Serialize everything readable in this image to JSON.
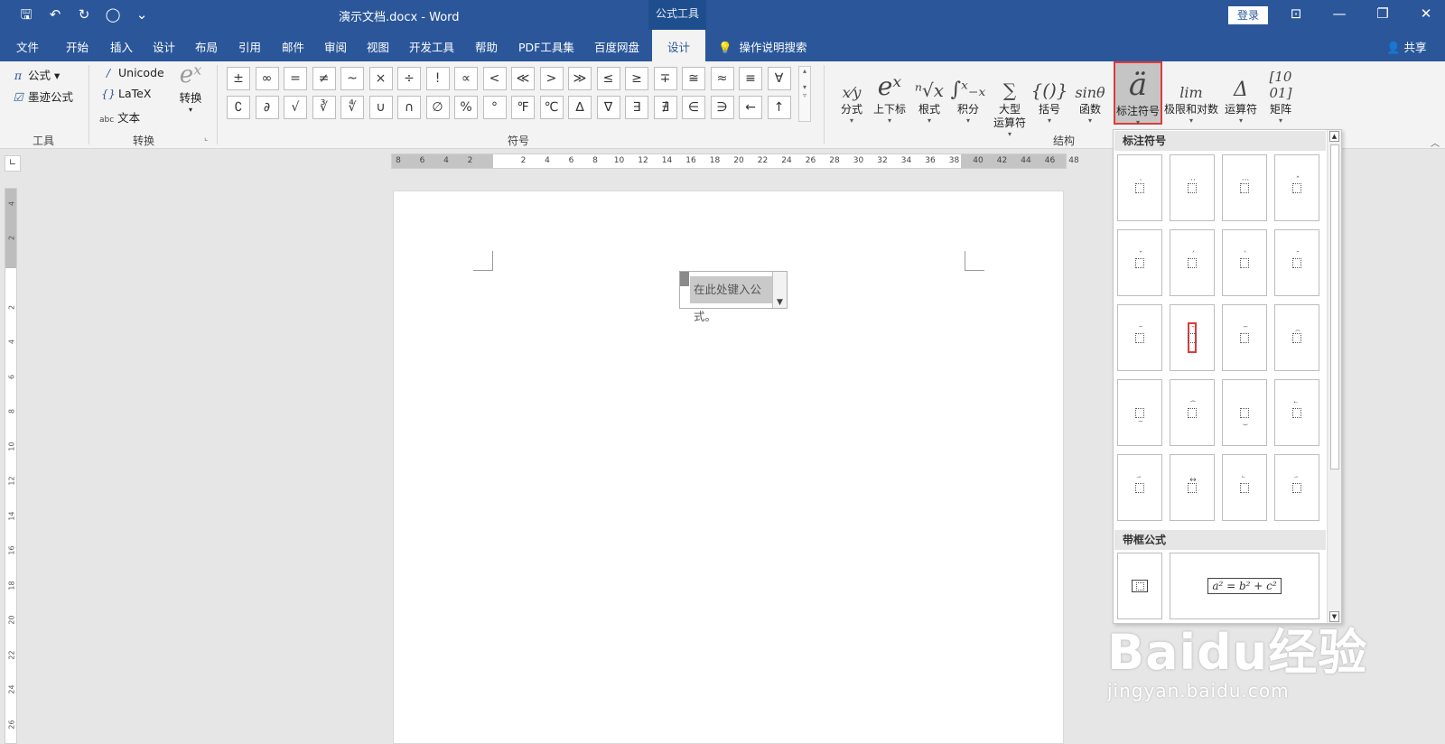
{
  "titlebar": {
    "qat": [
      {
        "name": "save-icon",
        "glyph": "🖫"
      },
      {
        "name": "undo-icon",
        "glyph": "↶"
      },
      {
        "name": "redo-icon",
        "glyph": "↻"
      },
      {
        "name": "circle-icon",
        "glyph": "◯"
      },
      {
        "name": "customize-qat-icon",
        "glyph": "⌄"
      }
    ],
    "doc_title": "演示文档.docx  -  Word",
    "context_tab": "公式工具",
    "login": "登录",
    "controls": {
      "ribbon_display": "⊡",
      "minimize": "—",
      "restore": "❐",
      "close": "✕"
    }
  },
  "tabs": [
    "文件",
    "开始",
    "插入",
    "设计",
    "布局",
    "引用",
    "邮件",
    "审阅",
    "视图",
    "开发工具",
    "帮助",
    "PDF工具集",
    "百度网盘"
  ],
  "active_tab": "设计",
  "tell_me": "操作说明搜索",
  "share": "共享",
  "ribbon": {
    "tools": {
      "equation": "公式",
      "ink_equation": "墨迹公式",
      "label": "工具",
      "pi": "π"
    },
    "convert": {
      "unicode": "Unicode",
      "latex": "LaTeX",
      "text": "文本",
      "convert_btn": "转换",
      "label": "转换",
      "abc": "abc"
    },
    "symbols": {
      "label": "符号",
      "row1": [
        "±",
        "∞",
        "=",
        "≠",
        "~",
        "×",
        "÷",
        "!",
        "∝",
        "<",
        "≪",
        ">",
        "≫",
        "≤",
        "≥",
        "∓",
        "≅",
        "≈",
        "≡",
        "∀"
      ],
      "row2": [
        "∁",
        "∂",
        "√",
        "∛",
        "∜",
        "∪",
        "∩",
        "∅",
        "%",
        "°",
        "℉",
        "℃",
        "∆",
        "∇",
        "∃",
        "∄",
        "∈",
        "∋",
        "←",
        "↑"
      ]
    },
    "structures": {
      "label": "结构",
      "items": [
        {
          "name": "fraction",
          "label": "分式",
          "glyph": "x⁄y"
        },
        {
          "name": "script",
          "label": "上下标",
          "glyph": "eˣ"
        },
        {
          "name": "radical",
          "label": "根式",
          "glyph": "ⁿ√x"
        },
        {
          "name": "integral",
          "label": "积分",
          "glyph": "∫ˣ₋ₓ"
        },
        {
          "name": "large-operator",
          "label": "大型\n运算符",
          "glyph": "∑"
        },
        {
          "name": "bracket",
          "label": "括号",
          "glyph": "{()}"
        },
        {
          "name": "function",
          "label": "函数",
          "glyph": "sinθ"
        },
        {
          "name": "accent",
          "label": "标注符号",
          "glyph": "ä"
        },
        {
          "name": "limit-log",
          "label": "极限和对数",
          "glyph": "lim"
        },
        {
          "name": "operator",
          "label": "运算符",
          "glyph": "Δ"
        },
        {
          "name": "matrix",
          "label": "矩阵",
          "glyph": "[10 01]"
        }
      ]
    }
  },
  "ruler": {
    "h_ticks": [
      "8",
      "6",
      "4",
      "2",
      "2",
      "4",
      "6",
      "8",
      "10",
      "12",
      "14",
      "16",
      "18",
      "20",
      "22",
      "24",
      "26",
      "28",
      "30",
      "32",
      "34",
      "36",
      "38",
      "40",
      "42",
      "44",
      "46",
      "48"
    ],
    "v_ticks": [
      "4",
      "2",
      "2",
      "4",
      "6",
      "8",
      "10",
      "12",
      "14",
      "16",
      "18",
      "20",
      "22",
      "24",
      "26"
    ]
  },
  "document": {
    "equation_placeholder": "在此处键入公式。"
  },
  "gallery": {
    "section_accents": "标注符号",
    "section_boxed": "带框公式",
    "boxed_equation": "a² = b² + c²",
    "accents": [
      {
        "top": "·",
        "bottom": ""
      },
      {
        "top": "··",
        "bottom": ""
      },
      {
        "top": "···",
        "bottom": ""
      },
      {
        "top": "ˆ",
        "bottom": ""
      },
      {
        "top": "ˇ",
        "bottom": ""
      },
      {
        "top": "´",
        "bottom": ""
      },
      {
        "top": "`",
        "bottom": ""
      },
      {
        "top": "˘",
        "bottom": ""
      },
      {
        "top": "˜",
        "bottom": ""
      },
      {
        "top": "¯",
        "bottom": ""
      },
      {
        "top": "‾",
        "bottom": ""
      },
      {
        "top": "⌢",
        "bottom": ""
      },
      {
        "top": "",
        "bottom": "⌣"
      },
      {
        "top": "⏞",
        "bottom": ""
      },
      {
        "top": "",
        "bottom": "⏟"
      },
      {
        "top": "⃖",
        "bottom": ""
      },
      {
        "top": "⃗",
        "bottom": ""
      },
      {
        "top": "↔",
        "bottom": ""
      },
      {
        "top": "⃐",
        "bottom": ""
      },
      {
        "top": "⃑",
        "bottom": ""
      }
    ],
    "highlighted_index": 9
  },
  "watermark": {
    "logo": "Baidu经验",
    "url": "jingyan.baidu.com"
  }
}
